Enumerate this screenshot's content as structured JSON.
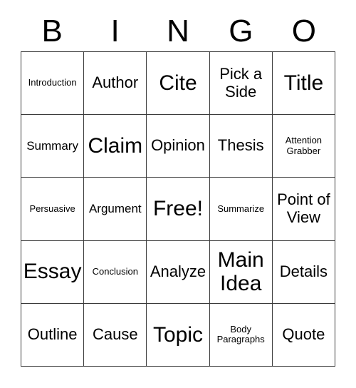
{
  "card": {
    "title_letters": [
      "B",
      "I",
      "N",
      "G",
      "O"
    ],
    "colors": {
      "border": "#3a3a3a",
      "text": "#000000",
      "background": "#ffffff"
    },
    "grid_size": "5x5",
    "free_space_label": "Free!",
    "cells": [
      {
        "label": "Introduction",
        "size": "xs"
      },
      {
        "label": "Author",
        "size": "md"
      },
      {
        "label": "Cite",
        "size": "xl"
      },
      {
        "label": "Pick a Side",
        "size": "md"
      },
      {
        "label": "Title",
        "size": "xl"
      },
      {
        "label": "Summary",
        "size": "sm"
      },
      {
        "label": "Claim",
        "size": "xl"
      },
      {
        "label": "Opinion",
        "size": "md"
      },
      {
        "label": "Thesis",
        "size": "md"
      },
      {
        "label": "Attention Grabber",
        "size": "xs"
      },
      {
        "label": "Persuasive",
        "size": "xs"
      },
      {
        "label": "Argument",
        "size": "sm"
      },
      {
        "label": "Free!",
        "size": "xl"
      },
      {
        "label": "Summarize",
        "size": "xs"
      },
      {
        "label": "Point of View",
        "size": "md"
      },
      {
        "label": "Essay",
        "size": "xl"
      },
      {
        "label": "Conclusion",
        "size": "xs"
      },
      {
        "label": "Analyze",
        "size": "md"
      },
      {
        "label": "Main Idea",
        "size": "xl"
      },
      {
        "label": "Details",
        "size": "md"
      },
      {
        "label": "Outline",
        "size": "md"
      },
      {
        "label": "Cause",
        "size": "md"
      },
      {
        "label": "Topic",
        "size": "xl"
      },
      {
        "label": "Body Paragraphs",
        "size": "xs"
      },
      {
        "label": "Quote",
        "size": "md"
      }
    ]
  }
}
